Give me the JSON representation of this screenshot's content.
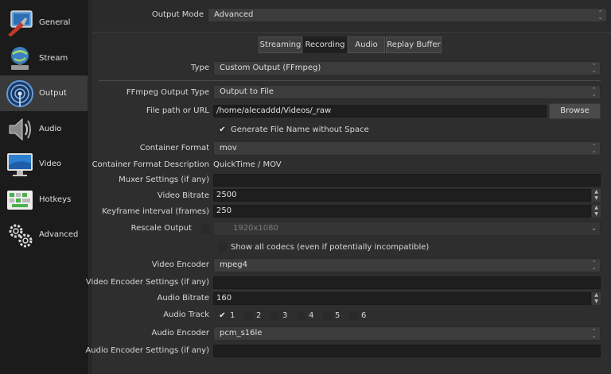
{
  "sidebar": {
    "items": [
      {
        "label": "General",
        "icon": "general-icon"
      },
      {
        "label": "Stream",
        "icon": "stream-icon"
      },
      {
        "label": "Output",
        "icon": "output-icon",
        "active": true
      },
      {
        "label": "Audio",
        "icon": "audio-icon"
      },
      {
        "label": "Video",
        "icon": "video-icon"
      },
      {
        "label": "Hotkeys",
        "icon": "hotkeys-icon"
      },
      {
        "label": "Advanced",
        "icon": "advanced-icon"
      }
    ]
  },
  "output_mode": {
    "label": "Output Mode",
    "value": "Advanced"
  },
  "tabs": [
    {
      "label": "Streaming"
    },
    {
      "label": "Recording",
      "active": true
    },
    {
      "label": "Audio"
    },
    {
      "label": "Replay Buffer"
    }
  ],
  "type": {
    "label": "Type",
    "value": "Custom Output (FFmpeg)"
  },
  "ffmpeg_output_type": {
    "label": "FFmpeg Output Type",
    "value": "Output to File"
  },
  "file_path": {
    "label": "File path or URL",
    "value": "/home/alecaddd/Videos/_raw",
    "browse_label": "Browse"
  },
  "generate_name": {
    "label": "Generate File Name without Space",
    "checked": true
  },
  "container_format": {
    "label": "Container Format",
    "value": "mov"
  },
  "container_desc": {
    "label": "Container Format Description",
    "value": "QuickTime / MOV"
  },
  "muxer": {
    "label": "Muxer Settings (if any)",
    "value": ""
  },
  "video_bitrate": {
    "label": "Video Bitrate",
    "value": "2500"
  },
  "keyframe": {
    "label": "Keyframe interval (frames)",
    "value": "250"
  },
  "rescale": {
    "label": "Rescale Output",
    "checked": false,
    "value": "1920x1080"
  },
  "show_all_codecs": {
    "label": "Show all codecs (even if potentially incompatible)",
    "checked": false
  },
  "video_encoder": {
    "label": "Video Encoder",
    "value": "mpeg4"
  },
  "video_encoder_settings": {
    "label": "Video Encoder Settings (if any)",
    "value": ""
  },
  "audio_bitrate": {
    "label": "Audio Bitrate",
    "value": "160"
  },
  "audio_track": {
    "label": "Audio Track",
    "tracks": [
      {
        "label": "1",
        "checked": true
      },
      {
        "label": "2",
        "checked": false
      },
      {
        "label": "3",
        "checked": false
      },
      {
        "label": "4",
        "checked": false
      },
      {
        "label": "5",
        "checked": false
      },
      {
        "label": "6",
        "checked": false
      }
    ]
  },
  "audio_encoder": {
    "label": "Audio Encoder",
    "value": "pcm_s16le"
  },
  "audio_encoder_settings": {
    "label": "Audio Encoder Settings (if any)",
    "value": ""
  },
  "glyphs": {
    "check": "✔",
    "up": "▲",
    "down": "▼",
    "updown_up": "⌃",
    "updown_down": "⌄"
  },
  "colors": {
    "active_item": "#3a3a3a",
    "active_tab": "#1f1f1f",
    "field_bg": "#1e1e1e"
  }
}
